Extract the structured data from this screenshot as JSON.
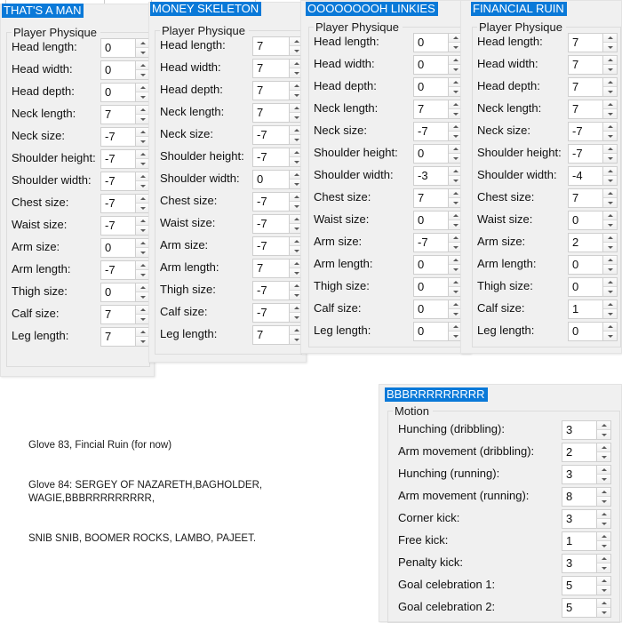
{
  "app": {
    "background": "#ffffff",
    "panel_bg": "#f0f0f0",
    "title_bg": "#0a79d8",
    "title_fg": "#ffffff"
  },
  "panels": [
    {
      "id": "panel-1",
      "title": "THAT'S A MAN",
      "group_label": "Player Physique",
      "rows": [
        {
          "label": "Head length:",
          "value": "0"
        },
        {
          "label": "Head width:",
          "value": "0"
        },
        {
          "label": "Head depth:",
          "value": "0"
        },
        {
          "label": "Neck length:",
          "value": "7"
        },
        {
          "label": "Neck size:",
          "value": "-7"
        },
        {
          "label": "Shoulder height:",
          "value": "-7"
        },
        {
          "label": "Shoulder width:",
          "value": "-7"
        },
        {
          "label": "Chest size:",
          "value": "-7"
        },
        {
          "label": "Waist size:",
          "value": "-7"
        },
        {
          "label": "Arm size:",
          "value": "0"
        },
        {
          "label": "Arm length:",
          "value": "-7"
        },
        {
          "label": "Thigh size:",
          "value": "0"
        },
        {
          "label": "Calf size:",
          "value": "7"
        },
        {
          "label": "Leg length:",
          "value": "7"
        }
      ]
    },
    {
      "id": "panel-2",
      "title": "MONEY SKELETON",
      "group_label": "Player Physique",
      "rows": [
        {
          "label": "Head length:",
          "value": "7"
        },
        {
          "label": "Head width:",
          "value": "7"
        },
        {
          "label": "Head depth:",
          "value": "7"
        },
        {
          "label": "Neck length:",
          "value": "7"
        },
        {
          "label": "Neck size:",
          "value": "-7"
        },
        {
          "label": "Shoulder height:",
          "value": "-7"
        },
        {
          "label": "Shoulder width:",
          "value": "0"
        },
        {
          "label": "Chest size:",
          "value": "-7"
        },
        {
          "label": "Waist size:",
          "value": "-7"
        },
        {
          "label": "Arm size:",
          "value": "-7"
        },
        {
          "label": "Arm length:",
          "value": "7"
        },
        {
          "label": "Thigh size:",
          "value": "-7"
        },
        {
          "label": "Calf size:",
          "value": "-7"
        },
        {
          "label": "Leg length:",
          "value": "7"
        }
      ]
    },
    {
      "id": "panel-3",
      "title": "OOOOOOOOH LINKIES",
      "group_label": "Player Physique",
      "rows": [
        {
          "label": "Head length:",
          "value": "0"
        },
        {
          "label": "Head width:",
          "value": "0"
        },
        {
          "label": "Head depth:",
          "value": "0"
        },
        {
          "label": "Neck length:",
          "value": "7"
        },
        {
          "label": "Neck size:",
          "value": "-7"
        },
        {
          "label": "Shoulder height:",
          "value": "0"
        },
        {
          "label": "Shoulder width:",
          "value": "-3"
        },
        {
          "label": "Chest size:",
          "value": "7"
        },
        {
          "label": "Waist size:",
          "value": "0"
        },
        {
          "label": "Arm size:",
          "value": "-7"
        },
        {
          "label": "Arm length:",
          "value": "0"
        },
        {
          "label": "Thigh size:",
          "value": "0"
        },
        {
          "label": "Calf size:",
          "value": "0"
        },
        {
          "label": "Leg length:",
          "value": "0"
        }
      ]
    },
    {
      "id": "panel-4",
      "title": "FINANCIAL RUIN",
      "group_label": "Player Physique",
      "rows": [
        {
          "label": "Head length:",
          "value": "7"
        },
        {
          "label": "Head width:",
          "value": "7"
        },
        {
          "label": "Head depth:",
          "value": "7"
        },
        {
          "label": "Neck length:",
          "value": "7"
        },
        {
          "label": "Neck size:",
          "value": "-7"
        },
        {
          "label": "Shoulder height:",
          "value": "-7"
        },
        {
          "label": "Shoulder width:",
          "value": "-4"
        },
        {
          "label": "Chest size:",
          "value": "7"
        },
        {
          "label": "Waist size:",
          "value": "0"
        },
        {
          "label": "Arm size:",
          "value": "2"
        },
        {
          "label": "Arm length:",
          "value": "0"
        },
        {
          "label": "Thigh size:",
          "value": "0"
        },
        {
          "label": "Calf size:",
          "value": "1"
        },
        {
          "label": "Leg length:",
          "value": "0"
        }
      ]
    },
    {
      "id": "panel-5",
      "title": "BBBRRRRRRRRR",
      "group_label": "Motion",
      "rows": [
        {
          "label": "Hunching (dribbling):",
          "value": "3"
        },
        {
          "label": "Arm movement (dribbling):",
          "value": "2"
        },
        {
          "label": "Hunching (running):",
          "value": "3"
        },
        {
          "label": "Arm movement (running):",
          "value": "8"
        },
        {
          "label": "Corner kick:",
          "value": "3"
        },
        {
          "label": "Free kick:",
          "value": "1"
        },
        {
          "label": "Penalty kick:",
          "value": "3"
        },
        {
          "label": "Goal celebration 1:",
          "value": "5"
        },
        {
          "label": "Goal celebration 2:",
          "value": "5"
        }
      ]
    }
  ],
  "note": {
    "line1": "Glove 83, Fincial Ruin (for now)",
    "line2": "Glove 84: SERGEY OF NAZARETH,BAGHOLDER, WAGIE,BBBRRRRRRRRR,",
    "line3": "SNIB SNIB, BOOMER ROCKS, LAMBO, PAJEET."
  }
}
